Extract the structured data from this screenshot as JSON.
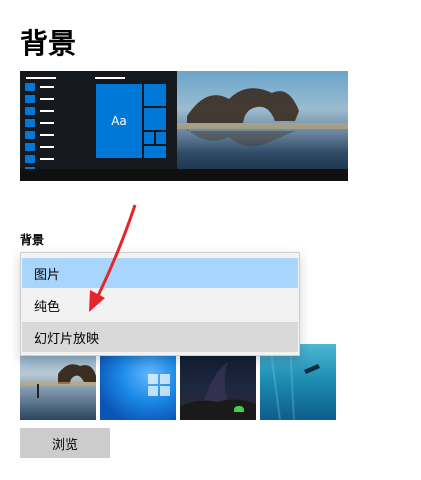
{
  "page": {
    "title": "背景"
  },
  "preview": {
    "tile_label": "Aa"
  },
  "background": {
    "label": "背景"
  },
  "dropdown": {
    "options": [
      "图片",
      "纯色",
      "幻灯片放映"
    ],
    "highlighted_index": 0,
    "hovered_index": 2
  },
  "browse": {
    "label": "浏览"
  },
  "colors": {
    "accent": "#0078d7",
    "selected_option_bg": "#a8d5fc",
    "hover_option_bg": "#d9d9d9",
    "annotation_arrow": "#e8242a",
    "button_bg": "#cccccc"
  }
}
